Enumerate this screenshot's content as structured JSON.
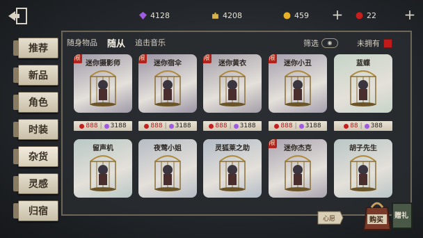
{
  "currencies": [
    {
      "icon": "purple-crystal-icon",
      "value": "4128",
      "color": "#a05be0"
    },
    {
      "icon": "gold-puzzle-icon",
      "value": "4208",
      "color": "#d8b24a"
    },
    {
      "icon": "gold-coin-icon",
      "value": "459",
      "color": "#e6b02a"
    },
    {
      "icon": "red-gem-icon",
      "value": "22",
      "color": "#c42020"
    }
  ],
  "sidebar": [
    "推荐",
    "新品",
    "角色",
    "时装",
    "杂货",
    "灵感",
    "归宿"
  ],
  "tabs": [
    "随身物品",
    "随从",
    "追击音乐"
  ],
  "filter_label": "筛选",
  "unowned_label": "未拥有",
  "cards": [
    {
      "name": "迷你摄影师",
      "badge": "限",
      "bg": "#9f9aa8",
      "red": "888",
      "purple": "3188"
    },
    {
      "name": "迷你宿伞",
      "badge": "限",
      "bg": "#9a93a4",
      "red": "888",
      "purple": "3188"
    },
    {
      "name": "迷你黄衣",
      "badge": "限",
      "bg": "#a49ea8",
      "red": "888",
      "purple": "3188"
    },
    {
      "name": "迷你小丑",
      "badge": "限",
      "bg": "#a59fae",
      "red": "888",
      "purple": "3188"
    },
    {
      "name": "蓝蝶",
      "badge": "",
      "bg": "#c6d4c8",
      "red": "88",
      "purple": "388"
    },
    {
      "name": "留声机",
      "badge": "",
      "bg": "#b9c8c5",
      "red": "",
      "purple": ""
    },
    {
      "name": "夜莺小姐",
      "badge": "",
      "bg": "#b6bcc4",
      "red": "",
      "purple": ""
    },
    {
      "name": "灵狐莱之助",
      "badge": "",
      "bg": "#b3bcc7",
      "red": "",
      "purple": ""
    },
    {
      "name": "迷你杰克",
      "badge": "限",
      "bg": "#a9a4b0",
      "red": "",
      "purple": ""
    },
    {
      "name": "胡子先生",
      "badge": "",
      "bg": "#b9c6c6",
      "red": "",
      "purple": ""
    }
  ],
  "bottom": {
    "tag": "心愿",
    "buy": "购买",
    "gift": "赠礼"
  }
}
